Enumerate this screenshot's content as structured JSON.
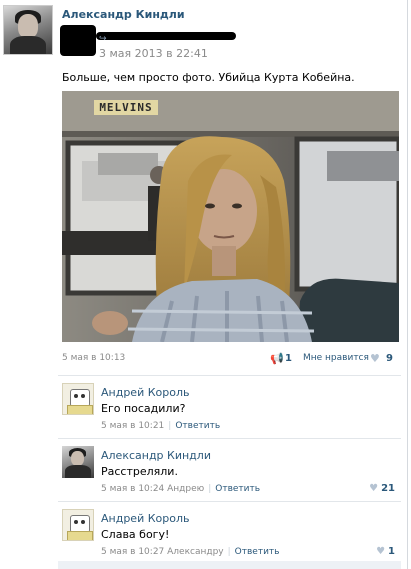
{
  "post": {
    "author_name": "Александр Киндли",
    "date": "3 мая 2013 в 22:41",
    "text": "Больше, чем просто фото. Убийца Курта Кобейна.",
    "photo_sign_text": "MELVINS",
    "meta": {
      "date": "5 мая в 10:13",
      "share_count": "1",
      "like_label": "Мне нравится",
      "like_count": "9"
    }
  },
  "comments": [
    {
      "author": "Андрей Король",
      "text": "Его посадили?",
      "date": "5 мая в 10:21",
      "reply_label": "Ответить",
      "likes": "",
      "avatar": "cartoon"
    },
    {
      "author": "Александр Киндли",
      "text": "Расстреляли.",
      "date": "5 мая в 10:24 Андрею",
      "reply_label": "Ответить",
      "likes": "21",
      "avatar": "photo"
    },
    {
      "author": "Андрей Король",
      "text": "Слава богу!",
      "date": "5 мая в 10:27 Александру",
      "reply_label": "Ответить",
      "likes": "1",
      "avatar": "cartoon"
    }
  ],
  "icons": {
    "share": "megaphone-icon",
    "like": "heart-icon",
    "repost": "repost-icon"
  },
  "colors": {
    "link": "#2b587a",
    "muted": "#8a8a8a",
    "icon": "#b5c3d2"
  }
}
